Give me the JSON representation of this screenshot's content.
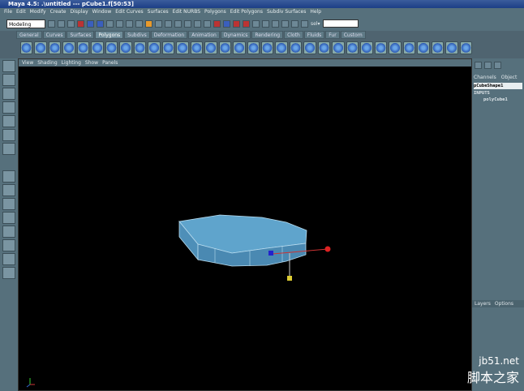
{
  "window": {
    "title": "Maya 4.5: .\\untitled  ---  pCube1.f[50:53]"
  },
  "menubar": [
    "File",
    "Edit",
    "Modify",
    "Create",
    "Display",
    "Window",
    "Edit Curves",
    "Surfaces",
    "Edit NURBS",
    "Polygons",
    "Edit Polygons",
    "Subdiv Surfaces",
    "Help"
  ],
  "toolbar": {
    "mode": "Modeling",
    "field_label": "sel▾"
  },
  "shelf": {
    "tabs": [
      "General",
      "Curves",
      "Surfaces",
      "Polygons",
      "Subdivs",
      "Deformation",
      "Animation",
      "Dynamics",
      "Rendering",
      "Cloth",
      "Fluids",
      "Fur",
      "Custom"
    ],
    "active": "Polygons"
  },
  "viewport": {
    "menu": [
      "View",
      "Shading",
      "Lighting",
      "Show",
      "Panels"
    ]
  },
  "channel_box": {
    "tabs": [
      "Channels",
      "Object"
    ],
    "shape": "pCubeShape1",
    "inputs_label": "INPUTS",
    "input_node": "polyCube1"
  },
  "layers": {
    "tabs": [
      "Layers",
      "Options"
    ]
  },
  "watermark": {
    "site": "jb51.net",
    "name": "脚本之家"
  }
}
